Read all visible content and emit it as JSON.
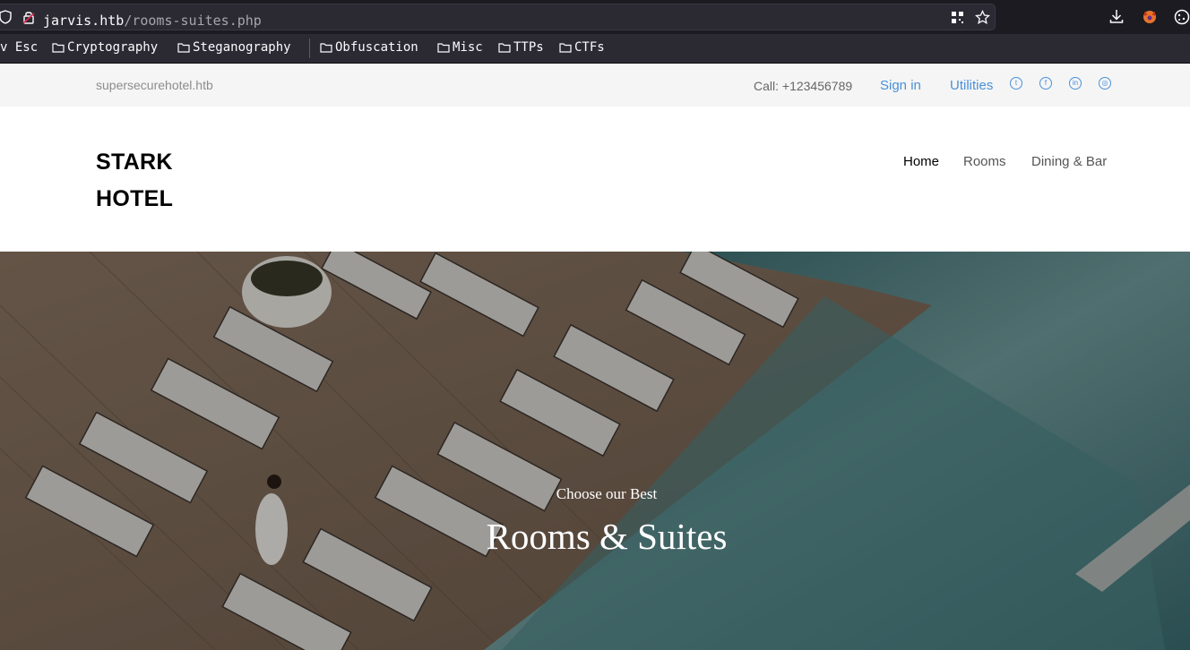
{
  "browser": {
    "url_host": "jarvis.htb",
    "url_path": "/rooms-suites.php",
    "bookmarks": [
      {
        "label": "v Esc",
        "folder": false
      },
      {
        "label": "Cryptography",
        "folder": true
      },
      {
        "label": "Steganography",
        "folder": true
      },
      {
        "label": "Obfuscation",
        "folder": true
      },
      {
        "label": "Misc",
        "folder": true
      },
      {
        "label": "TTPs",
        "folder": true
      },
      {
        "label": "CTFs",
        "folder": true
      }
    ]
  },
  "topbar": {
    "domain": "supersecurehotel.htb",
    "call": "Call: +123456789",
    "sign_in": "Sign in",
    "utilities": "Utilities",
    "social_icons": [
      "twitter-icon",
      "facebook-icon",
      "linkedin-icon",
      "dribbble-icon"
    ]
  },
  "header": {
    "logo": "STARK HOTEL",
    "nav": [
      "Home",
      "Rooms",
      "Dining & Bar"
    ]
  },
  "hero": {
    "subtitle": "Choose our Best",
    "title": "Rooms & Suites"
  },
  "colors": {
    "link": "#4a90d9",
    "topbar_bg": "#f5f5f5",
    "chrome_bg": "#2b2a33"
  }
}
